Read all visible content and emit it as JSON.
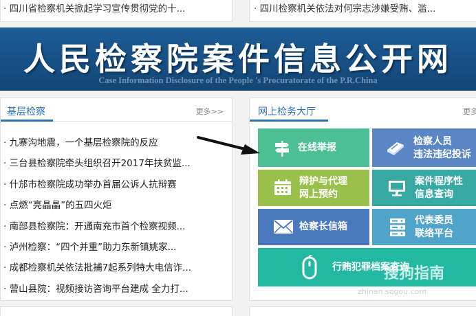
{
  "top_news": {
    "left": "· 四川省检察机关掀起学习宣传贯彻党的十...",
    "right": "· 四川检察机关依法对何宗志涉嫌受贿、滥..."
  },
  "banner": {
    "title": "人民检察院案件信息公开网",
    "subtitle": "Case Information Disclosure of the People 's Procuratorate of the P.R.China"
  },
  "local": {
    "title": "基层检察",
    "more": "更多>>",
    "items": [
      "· 九寨沟地震，一个基层检察院的反应",
      "· 三台县检察院牵头组织召开2017年扶贫监...",
      "· 什邡市检察院成功举办首届公诉人抗辩赛",
      "· 点燃“亮晶晶”的五四火炬",
      "· 南部县检察院：开通南充市首个检察视频...",
      "· 泸州检察：“四个并重”助力东新镇姚家...",
      "· 成都检察机关依法批捕7起系列特大电信诈...",
      "· 营山县院：视频接访咨询平台建成 全力打..."
    ]
  },
  "services": {
    "title": "网上检务大厅",
    "more": "更多",
    "online_report": "在线举报",
    "conduct_l1": "检察人员",
    "conduct_l2": "违法违纪投诉",
    "defense_l1": "辩护与代理",
    "defense_l2": "网上预约",
    "case_l1": "案件程序性",
    "case_l2": "信息查询",
    "mailbox": "检察长信箱",
    "deputy_l1": "代表委员",
    "deputy_l2": "联络平台",
    "bribery": "行贿犯罪档案查询"
  },
  "watermark": {
    "text": "搜狗指南",
    "url": "zhinan.sogou.com"
  },
  "colors": {
    "banner": "#174f84",
    "accent": "#2a6fb8",
    "green": "#4dbf95",
    "blue": "#5b86c6",
    "olive": "#98c04a",
    "teal": "#37a9a2"
  },
  "icons": [
    "signpost-icon",
    "book-pen-icon",
    "calendar-icon",
    "monitor-icon",
    "envelope-icon",
    "server-icon",
    "mouse-icon",
    "arrow-icon"
  ]
}
